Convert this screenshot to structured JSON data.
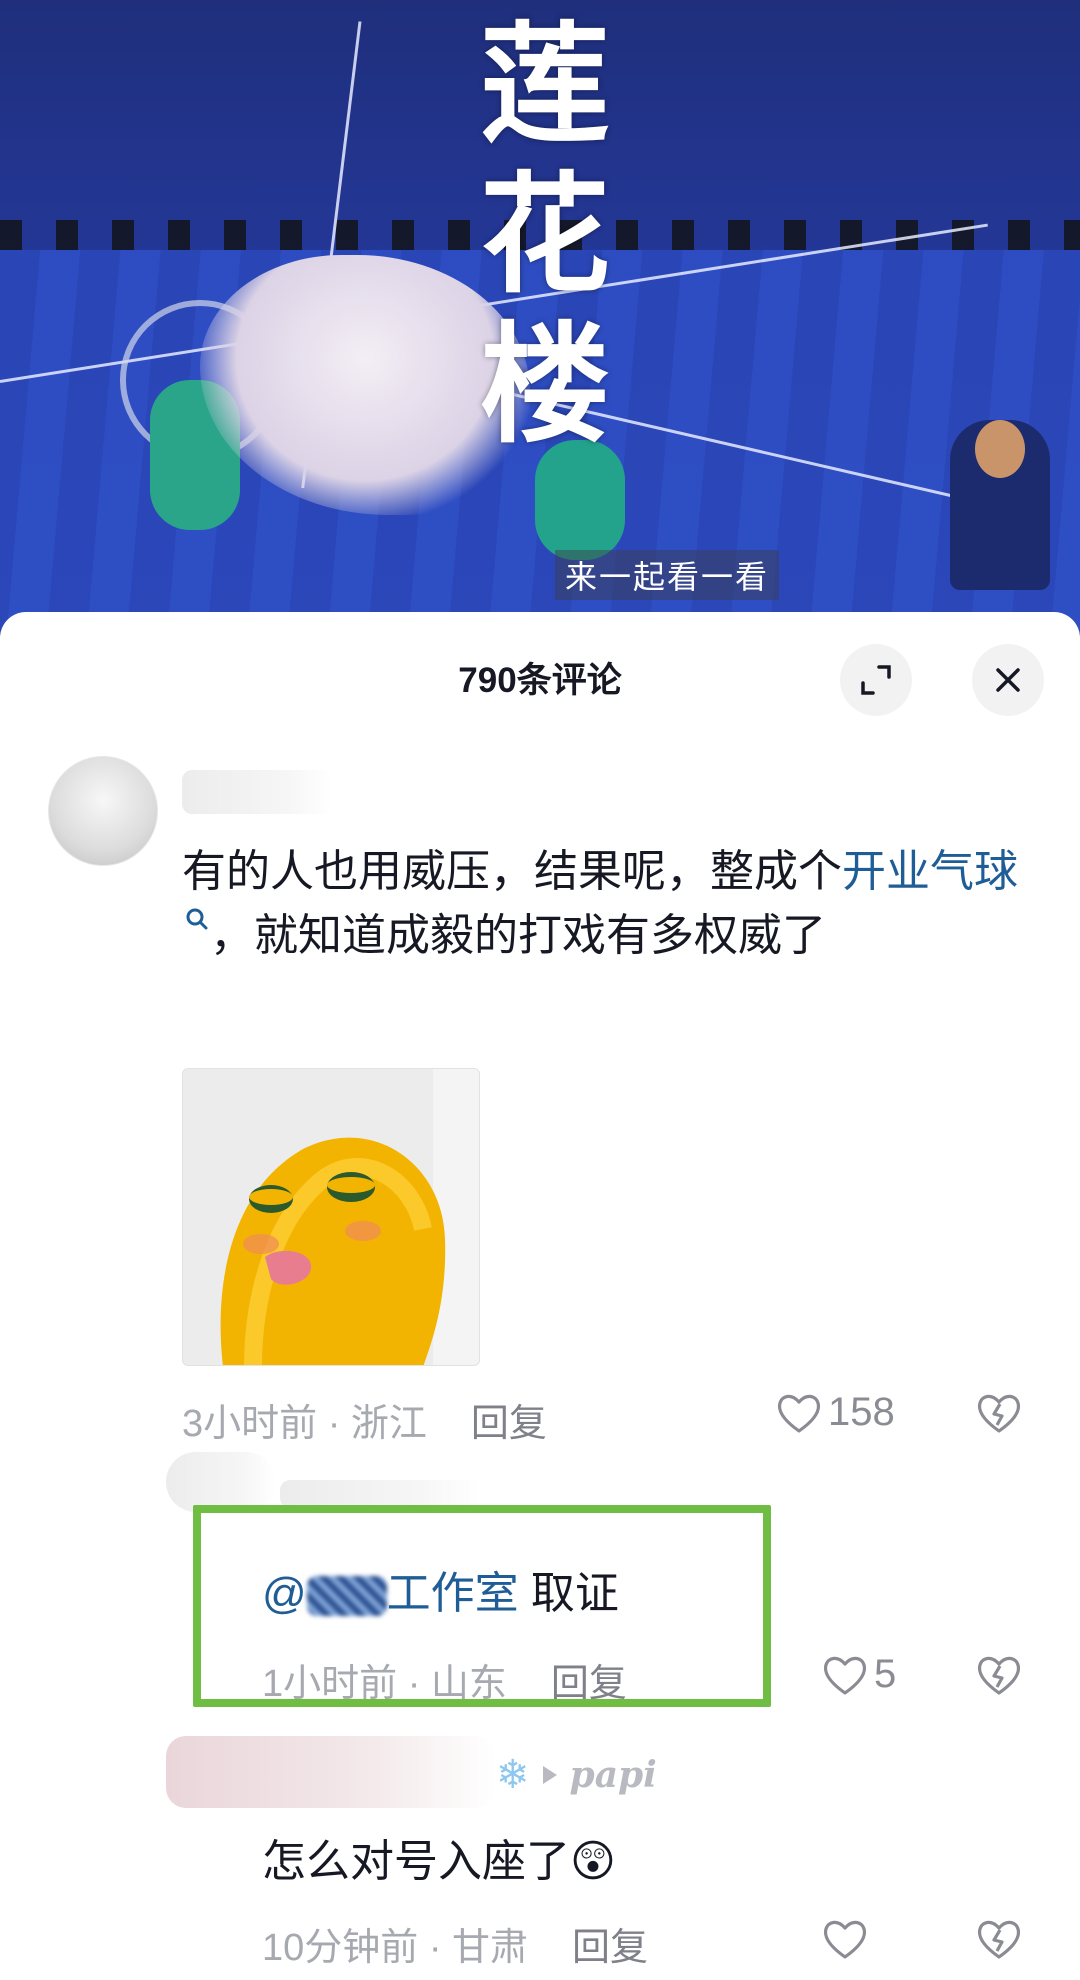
{
  "video": {
    "title_art_chars": [
      "莲",
      "花",
      "楼"
    ],
    "subtitle": "来一起看一看"
  },
  "sheet": {
    "title": "790条评论",
    "expand_icon": "collapse-icon",
    "close_icon": "close-icon"
  },
  "comments": [
    {
      "text_before_link": "有的人也用威压，结果呢，整成个",
      "link_text": "开业气球",
      "text_after_link": "，就知道成毅的打戏有多权威了",
      "meta_time_location": "3小时前 · 浙江",
      "reply_label": "回复",
      "like_count": "158"
    },
    {
      "mention_suffix": "工作室",
      "text": "取证",
      "meta_time_location": "1小时前 · 山东",
      "reply_label": "回复",
      "like_count": "5"
    },
    {
      "name_tag": "papi",
      "text": "怎么对号入座了",
      "emoji": "😲",
      "meta_time_location": "10分钟前 · 甘肃",
      "reply_label": "回复",
      "like_count": ""
    }
  ],
  "colors": {
    "link": "#1f5d96",
    "highlight_border": "#6fbd43",
    "meta": "#a7a9b0"
  }
}
